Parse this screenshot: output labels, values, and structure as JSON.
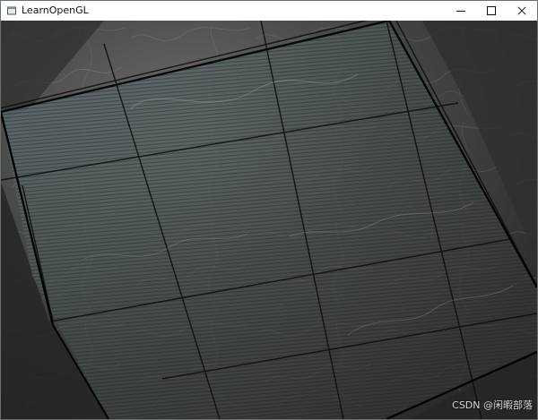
{
  "window": {
    "title": "LearnOpenGL",
    "buttons": {
      "minimize": "minimize",
      "maximize": "maximize",
      "close": "close"
    }
  },
  "viewport": {
    "watermark": "CSDN @闲暇部落",
    "icons": {
      "app": "app-window-icon",
      "minimize": "minimize-icon",
      "maximize": "maximize-icon",
      "close": "close-icon"
    },
    "colors": {
      "stone_dark": "#2b2b2b",
      "stone_mid": "#4b4b4b",
      "stone_light": "#6f6f6f",
      "seam": "#0d0d0d",
      "shadow_stripe": "#202020",
      "light_tint": "#66777a"
    }
  }
}
